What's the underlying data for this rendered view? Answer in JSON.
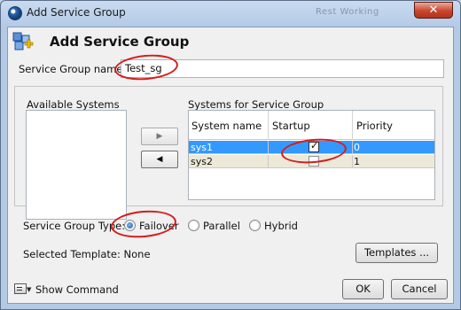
{
  "window": {
    "title": "Add Service Group",
    "ghost_text": "Rest Working",
    "close_label": "✕"
  },
  "header": {
    "title": "Add Service Group",
    "icon": "service-group-icon"
  },
  "name_field": {
    "label": "Service Group name:",
    "value": "Test_sg"
  },
  "available_systems": {
    "label": "Available Systems",
    "items": []
  },
  "move_buttons": {
    "add_label": "▶",
    "remove_label": "◀"
  },
  "systems_table": {
    "label": "Systems for Service Group",
    "columns": [
      "System name",
      "Startup",
      "Priority"
    ],
    "rows": [
      {
        "system": "sys1",
        "startup": true,
        "priority": "0",
        "selected": true
      },
      {
        "system": "sys2",
        "startup": false,
        "priority": "1",
        "selected": false
      }
    ]
  },
  "group_type": {
    "label": "Service Group Type:",
    "options": [
      {
        "label": "Failover",
        "selected": true
      },
      {
        "label": "Parallel",
        "selected": false
      },
      {
        "label": "Hybrid",
        "selected": false
      }
    ]
  },
  "template": {
    "label": "Selected Template: None",
    "button_label": "Templates ..."
  },
  "footer": {
    "show_command_label": "Show Command",
    "ok_label": "OK",
    "cancel_label": "Cancel"
  },
  "colors": {
    "selection": "#3399ff",
    "annotation": "#d41c1c",
    "alt_row": "#ece9d8"
  }
}
